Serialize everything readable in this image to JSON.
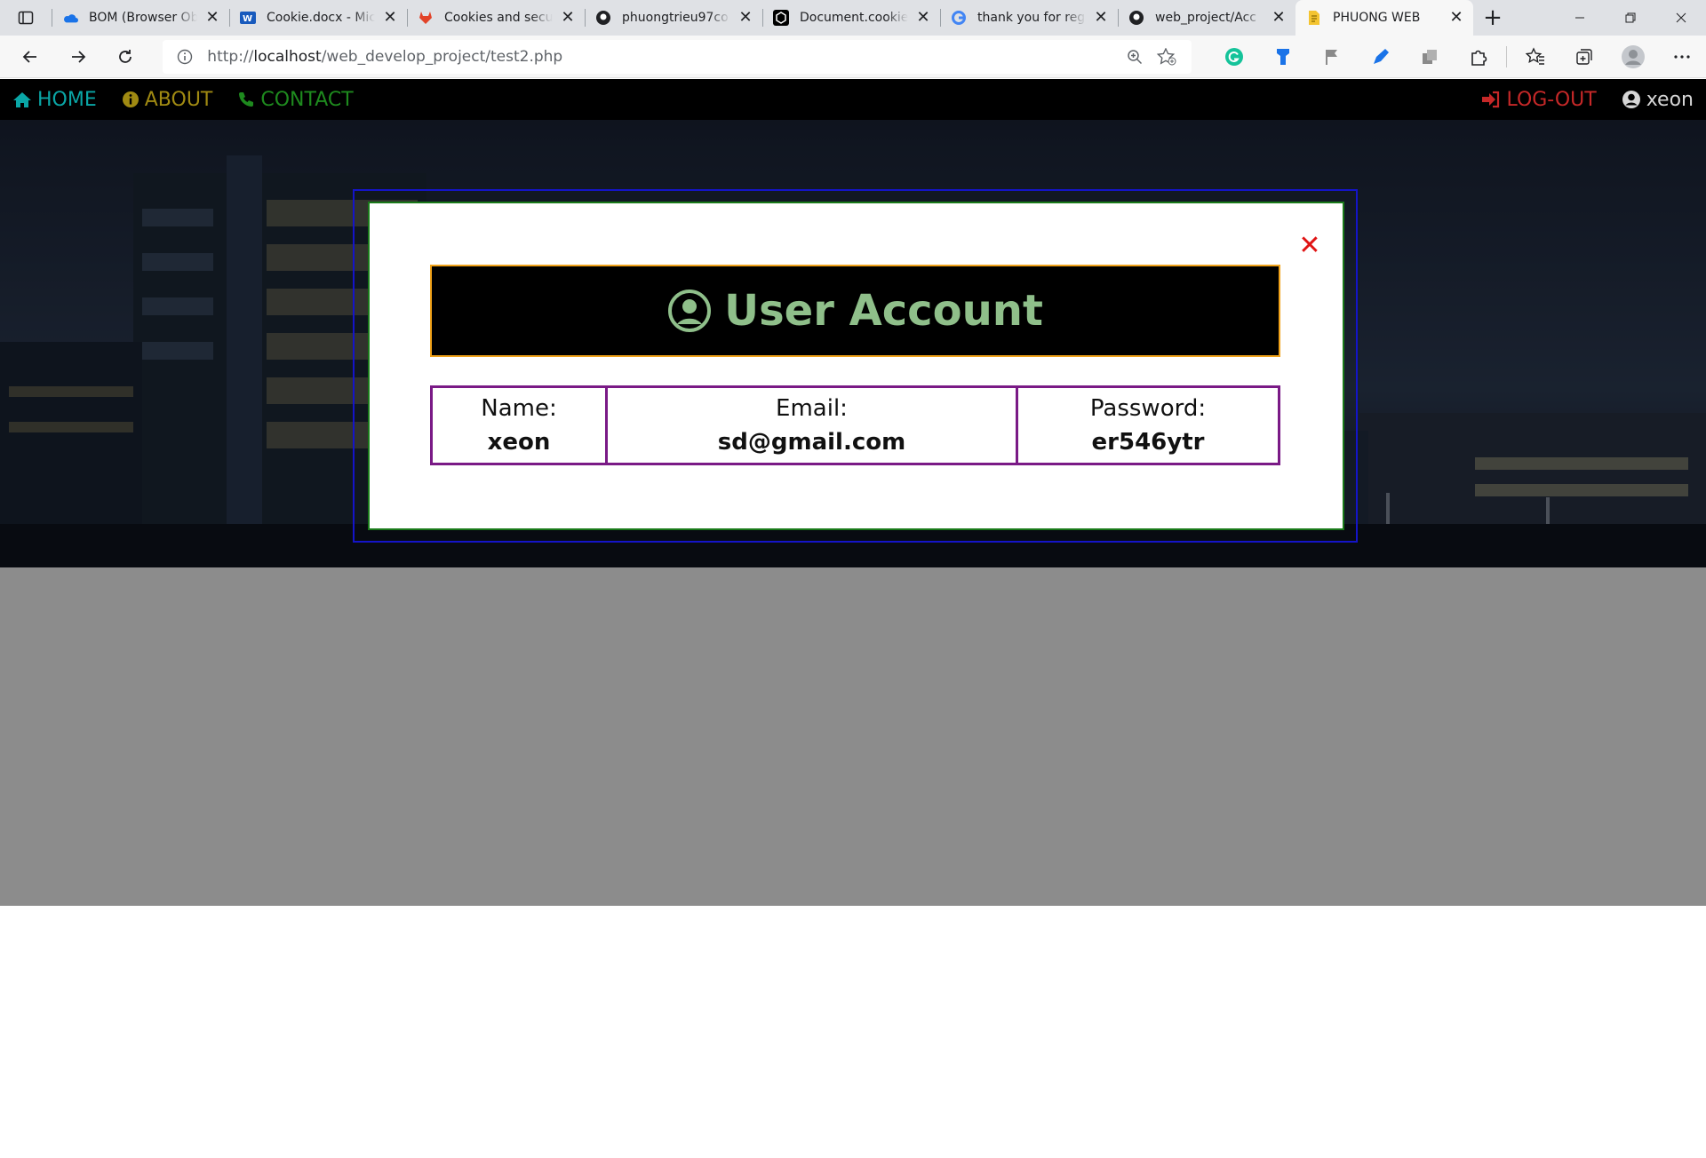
{
  "browser": {
    "tabs": [
      {
        "title": "BOM (Browser Ob",
        "icon": "onedrive-icon"
      },
      {
        "title": "Cookie.docx - Mic",
        "icon": "word-icon"
      },
      {
        "title": "Cookies and secu",
        "icon": "gitlab-icon"
      },
      {
        "title": "phuongtrieu97co",
        "icon": "github-icon"
      },
      {
        "title": "Document.cookie",
        "icon": "codepen-icon"
      },
      {
        "title": "thank you for reg",
        "icon": "google-icon"
      },
      {
        "title": "web_project/Acc",
        "icon": "github-icon"
      },
      {
        "title": "PHUONG WEB",
        "icon": "page-icon",
        "active": true
      }
    ],
    "tab_close_glyph": "✕",
    "new_tab_glyph": "+",
    "url": {
      "scheme": "http://",
      "host": "localhost",
      "path": "/web_develop_project/test2.php"
    }
  },
  "site_nav": {
    "home": "HOME",
    "about": "ABOUT",
    "contact": "CONTACT",
    "logout": "LOG-OUT",
    "username": "xeon"
  },
  "modal": {
    "close_glyph": "✕",
    "title": "User Account",
    "fields": [
      {
        "label": "Name:",
        "value": "xeon"
      },
      {
        "label": "Email:",
        "value": "sd@gmail.com"
      },
      {
        "label": "Password:",
        "value": "er546ytr"
      }
    ]
  },
  "colors": {
    "nav_home": "#0aa6a6",
    "nav_about": "#a08a12",
    "nav_contact": "#1e8a1e",
    "nav_logout": "#c62828",
    "modal_title": "#8fbf8a",
    "modal_outer_border": "#1414c8",
    "modal_border": "#1a7a1a",
    "header_border": "#f0a21a",
    "table_border": "#7a1a86",
    "close": "#e01414"
  }
}
